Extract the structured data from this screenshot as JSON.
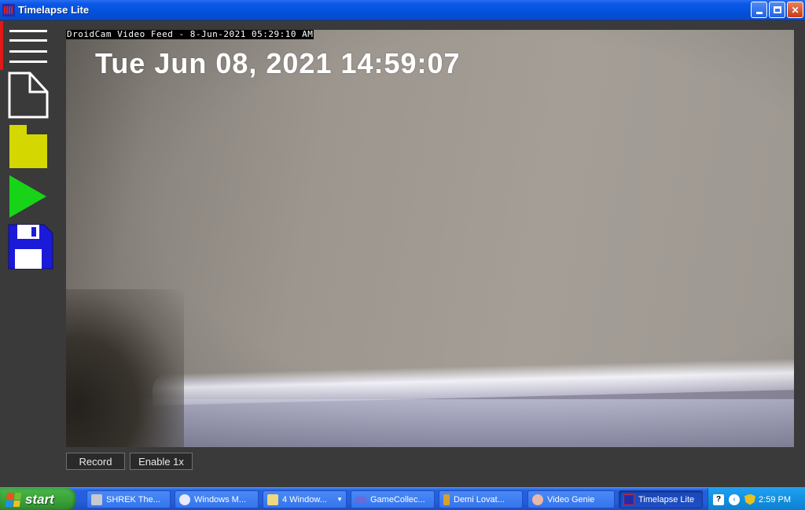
{
  "window": {
    "title": "Timelapse Lite"
  },
  "sidebar": {
    "items": [
      {
        "icon": "hamburger-menu-icon"
      },
      {
        "icon": "new-document-icon"
      },
      {
        "icon": "folder-icon"
      },
      {
        "icon": "play-icon"
      },
      {
        "icon": "save-floppy-icon"
      }
    ]
  },
  "video": {
    "feed_label": "DroidCam Video Feed -  8-Jun-2021 05:29:10 AM",
    "timestamp": "Tue Jun 08, 2021 14:59:07"
  },
  "controls": {
    "record_label": "Record",
    "enable_label": "Enable 1x"
  },
  "taskbar": {
    "start_label": "start",
    "tasks": [
      {
        "label": "SHREK The...",
        "icon": "clapper-icon"
      },
      {
        "label": "Windows M...",
        "icon": "media-player-icon"
      },
      {
        "label": "4 Window...",
        "icon": "folder-icon"
      },
      {
        "label": "GameCollec...",
        "icon": "gamepad-icon"
      },
      {
        "label": "Demi Lovat...",
        "icon": "torch-icon"
      },
      {
        "label": "Video Genie",
        "icon": "palette-icon"
      },
      {
        "label": "Timelapse Lite",
        "icon": "timelapse-app-icon"
      }
    ],
    "clock": "2:59 PM"
  },
  "colors": {
    "accent_red": "#e01818",
    "play_green": "#18d418",
    "folder_yellow": "#d4d800",
    "floppy_blue": "#1a1ad8"
  }
}
